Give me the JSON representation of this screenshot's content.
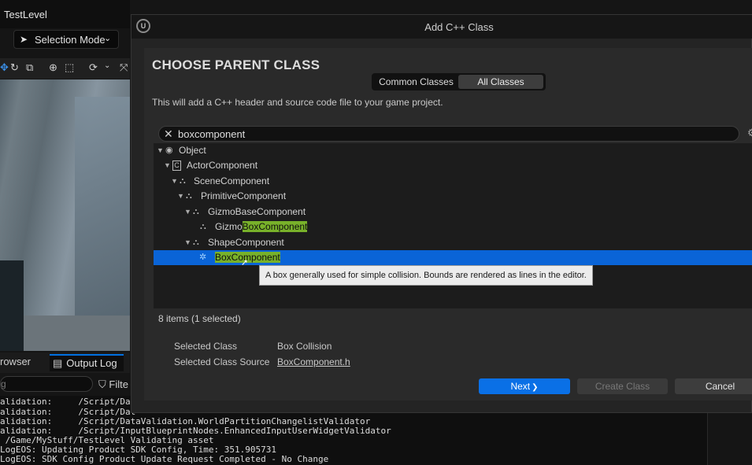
{
  "editor": {
    "level_title": "TestLevel",
    "selection_mode": "Selection Mode",
    "tabs": {
      "browser": "rowser",
      "output_log": "Output Log"
    },
    "log_search_placeholder": "g",
    "filters_label": "Filte",
    "log_lines": [
      "alidation:     /Script/Dat",
      "alidation:     /Script/Dat",
      "alidation:     /Script/DataValidation.WorldPartitionChangelistValidator",
      "alidation:     /Script/InputBlueprintNodes.EnhancedInputUserWidgetValidator",
      " /Game/MyStuff/TestLevel Validating asset",
      "LogEOS: Updating Product SDK Config, Time: 351.905731",
      "LogEOS: SDK Config Product Update Request Completed - No Change"
    ]
  },
  "dialog": {
    "title": "Add C++ Class",
    "heading": "CHOOSE PARENT CLASS",
    "tabs": {
      "common": "Common Classes",
      "all": "All Classes"
    },
    "description": "This will add a C++ header and source code file to your game project.",
    "search_value": "boxcomponent",
    "tree": [
      {
        "label": "Object",
        "depth": 0,
        "expanded": true,
        "icon": "object-icon"
      },
      {
        "label": "ActorComponent",
        "depth": 1,
        "expanded": true,
        "icon": "class-icon"
      },
      {
        "label": "SceneComponent",
        "depth": 2,
        "expanded": true,
        "icon": "component-icon"
      },
      {
        "label": "PrimitiveComponent",
        "depth": 3,
        "expanded": true,
        "icon": "component-icon"
      },
      {
        "label_pre": "",
        "label": "GizmoBaseComponent",
        "depth": 4,
        "expanded": true,
        "icon": "component-icon"
      },
      {
        "label_pre": "Gizmo",
        "label_match": "BoxComponent",
        "depth": 5,
        "icon": "component-icon"
      },
      {
        "label": "ShapeComponent",
        "depth": 4,
        "expanded": true,
        "icon": "component-icon"
      },
      {
        "label_pre": "",
        "label_match": "BoxComponent",
        "depth": 5,
        "icon": "box-collision-icon",
        "selected": true
      }
    ],
    "tooltip": "A box generally used for simple collision. Bounds are rendered as lines in the editor.",
    "item_count": "8 items (1 selected)",
    "selected_class_label": "Selected Class",
    "selected_class_value": "Box Collision",
    "selected_source_label": "Selected Class Source",
    "selected_source_value": "BoxComponent.h",
    "buttons": {
      "next": "Next",
      "next_glyph": "❯",
      "create": "Create Class",
      "cancel": "Cancel"
    }
  },
  "colors": {
    "accent": "#0a70e6",
    "match_highlight": "#78b12a",
    "selection": "#0a64d7"
  }
}
